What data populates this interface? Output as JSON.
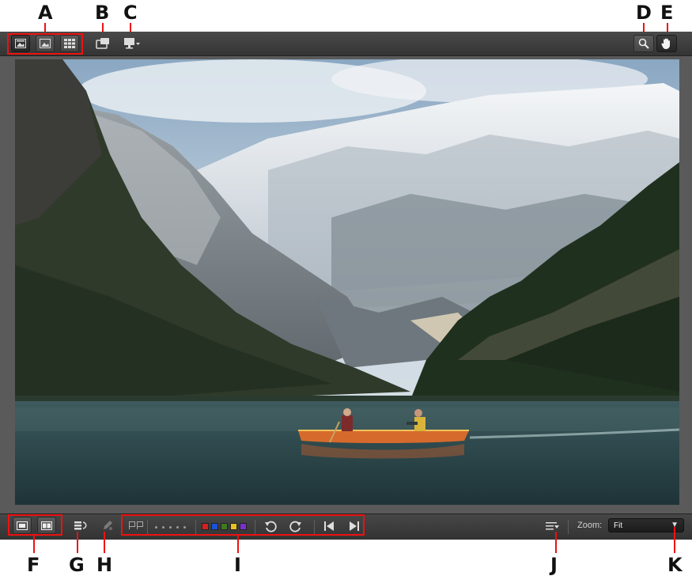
{
  "callouts": {
    "A": "A",
    "B": "B",
    "C": "C",
    "D": "D",
    "E": "E",
    "F": "F",
    "G": "G",
    "H": "H",
    "I": "I",
    "J": "J",
    "K": "K"
  },
  "toolbar_top": {
    "view_modes": [
      "browser-view-icon",
      "single-view-icon",
      "grid-view-icon"
    ],
    "compare_icon": "compare-window-icon",
    "display_icon": "monitor-dropdown-icon",
    "zoom_tool_icon": "magnifier-icon",
    "pan_tool_icon": "hand-icon"
  },
  "toolbar_bottom": {
    "layout_modes": [
      "single-layout-icon",
      "split-layout-icon"
    ],
    "sort_icon": "sort-icon",
    "edit_icon": "pen-icon",
    "rating_dots": 5,
    "color_labels": [
      "#d42020",
      "#1a53d8",
      "#3f7a1f",
      "#e6c21a",
      "#7a2fd0"
    ],
    "rotate_left_icon": "rotate-left-icon",
    "rotate_right_icon": "rotate-right-icon",
    "prev_icon": "previous-icon",
    "next_icon": "next-icon",
    "options_icon": "list-options-icon",
    "zoom_label": "Zoom:",
    "zoom_value": "Fit",
    "zoom_arrow": "▼"
  },
  "colors": {
    "callout_box": "#e11111",
    "toolbar": "#3b3b3b",
    "viewer_bg": "#5a5a5a"
  }
}
